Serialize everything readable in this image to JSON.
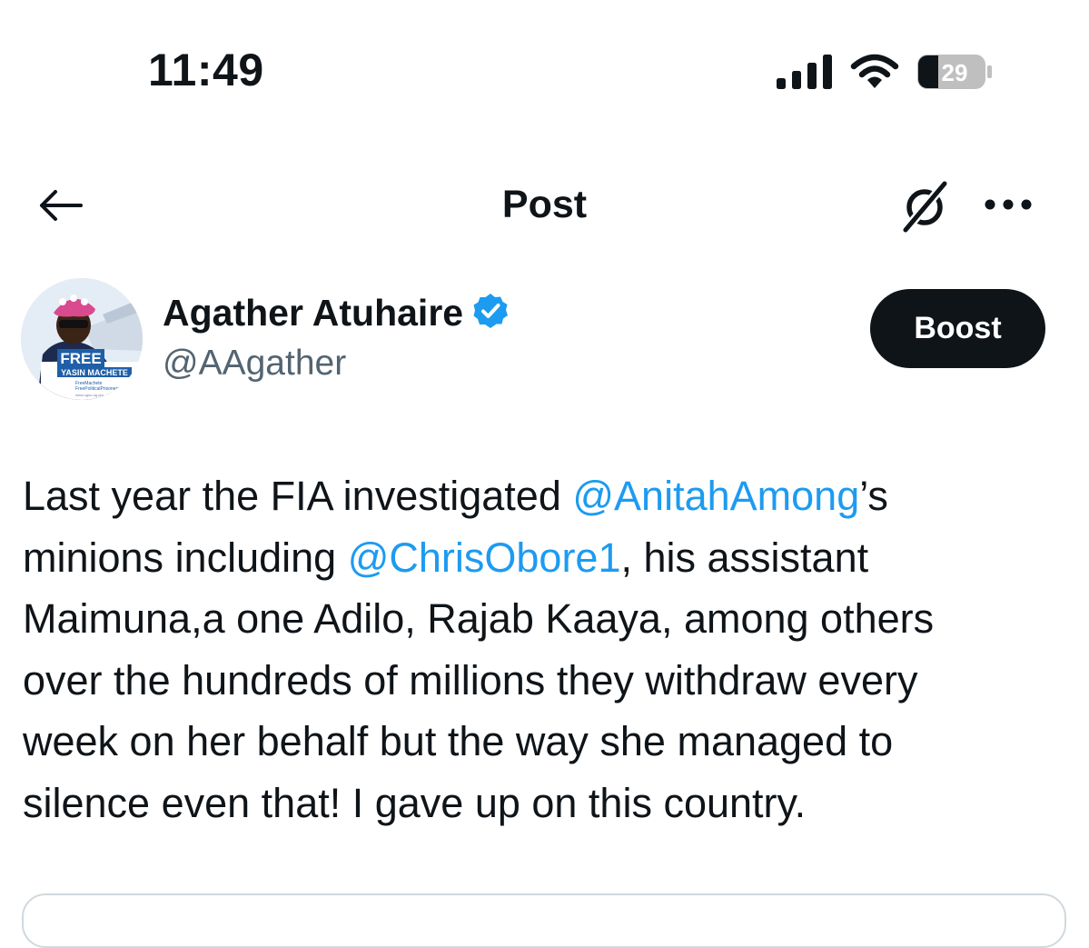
{
  "status_bar": {
    "time": "11:49",
    "battery_level": "29",
    "icons": [
      "signal-icon",
      "wifi-icon",
      "battery-icon"
    ]
  },
  "header": {
    "title": "Post",
    "back_icon": "arrow-left-icon",
    "grok_icon": "grok-icon",
    "more_icon": "more-horizontal-icon"
  },
  "author": {
    "name": "Agather Atuhaire",
    "handle": "@AAgather",
    "verified": true,
    "avatar_text": {
      "line1": "FREE",
      "line2": "YASIN MACHETE",
      "line3": "FreeMachete",
      "line4": "FreePoliticalPrisonersInUg",
      "line5": "www.ugoo.ug.org"
    }
  },
  "actions": {
    "boost_label": "Boost"
  },
  "post": {
    "line1_a": "Last year the FIA investigated ",
    "mention1": "@AnitahAmong",
    "line1_b": "’s",
    "line2_a": "minions including ",
    "mention2": "@ChrisObore1",
    "line2_b": ", his assistant",
    "line3": "Maimuna,a one Adilo, Rajab Kaaya, among others",
    "line4": "over the hundreds of millions they withdraw every",
    "line5": "week on her behalf but the way she managed to",
    "line6": "silence even that! I gave up on this country."
  },
  "colors": {
    "text": "#0f1419",
    "secondary_text": "#536471",
    "link": "#1d9bf0",
    "verified_badge": "#1d9bf0",
    "boost_background": "#0f1419",
    "border": "#cfd9de"
  }
}
